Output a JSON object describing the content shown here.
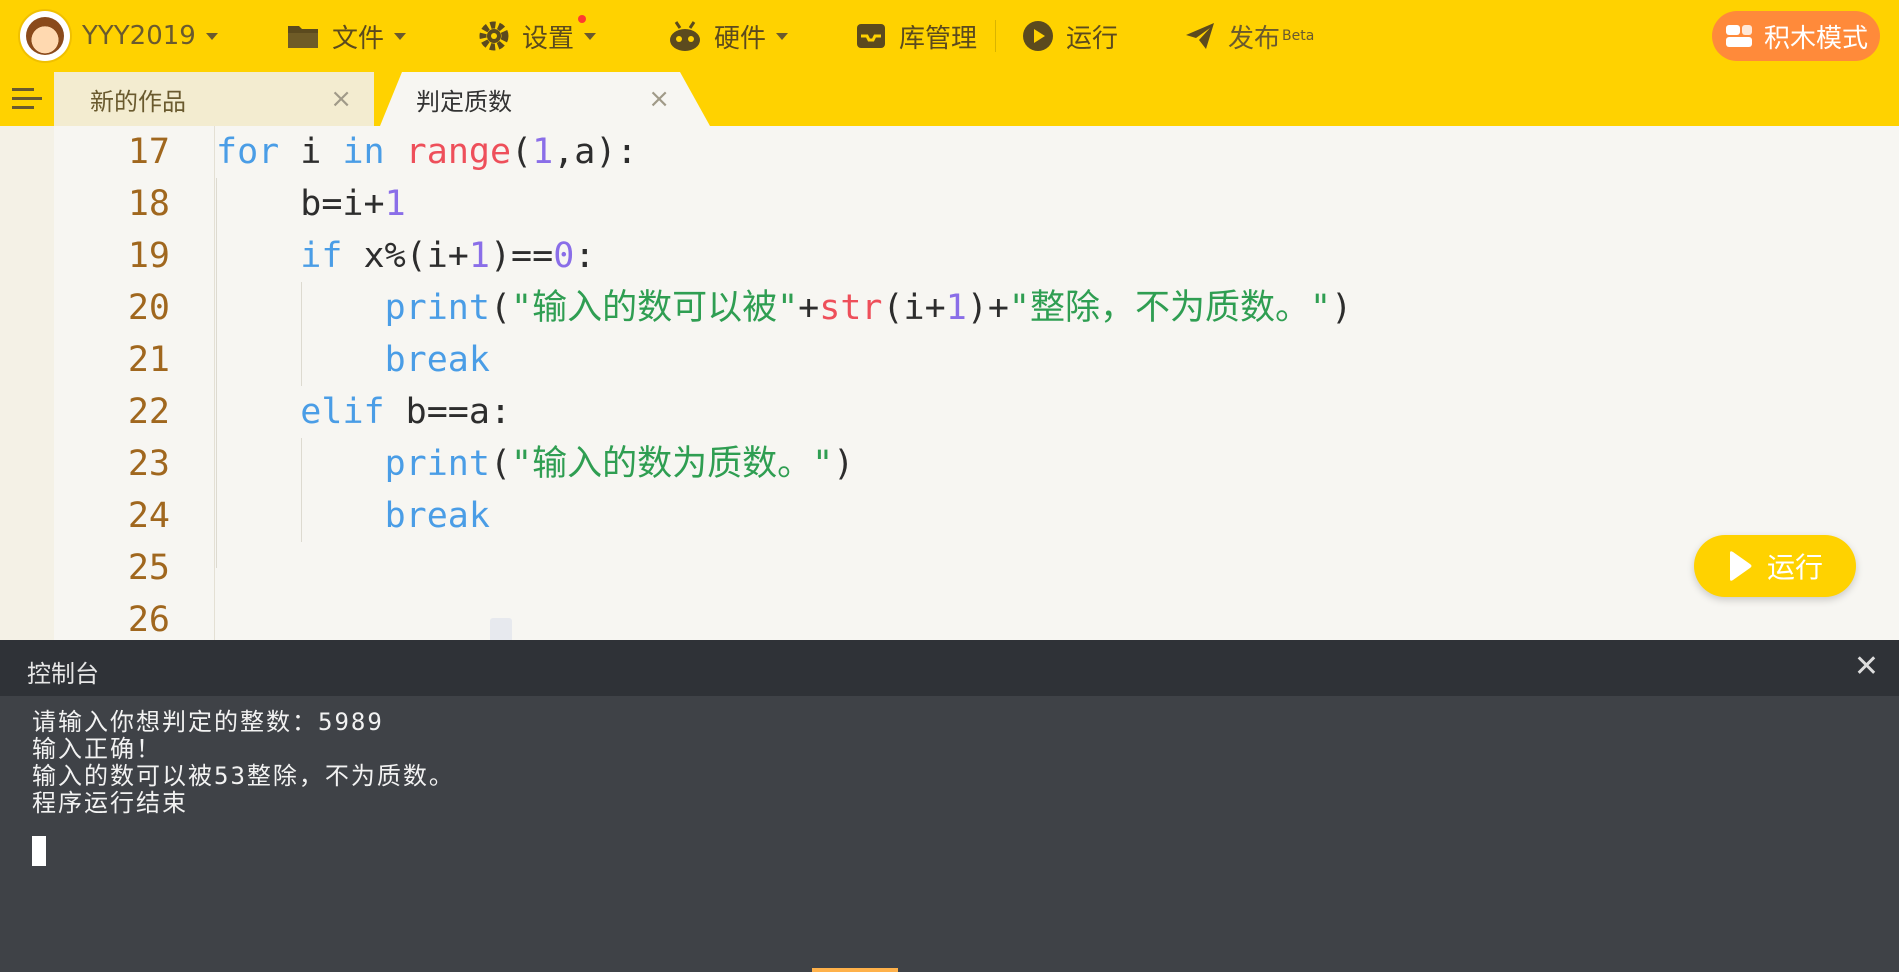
{
  "colors": {
    "accent": "#ffd200",
    "orange": "#ff8a3a",
    "keyword": "#4a9de6",
    "builtin": "#ee4f5a",
    "number": "#8a6ee8",
    "string": "#2f9e52",
    "line_number": "#a0671e",
    "console_bg": "#3f4247"
  },
  "header": {
    "user": {
      "name": "YYY2019",
      "icon": "avatar-icon"
    },
    "menu": [
      {
        "label": "文件",
        "icon": "folder-icon",
        "dropdown": true
      },
      {
        "label": "设置",
        "icon": "gear-icon",
        "dropdown": true,
        "badge_dot": true
      },
      {
        "label": "硬件",
        "icon": "robot-icon",
        "dropdown": true
      },
      {
        "label": "库管理",
        "icon": "inbox-icon",
        "dropdown": false
      },
      {
        "label": "运行",
        "icon": "play-circle-icon",
        "dropdown": false
      },
      {
        "label": "发布",
        "sup": "Beta",
        "icon": "paper-plane-icon",
        "dropdown": false
      }
    ],
    "blocks_mode_label": "积木模式"
  },
  "tabs": [
    {
      "label": "新的作品",
      "active": false
    },
    {
      "label": "判定质数",
      "active": true
    }
  ],
  "editor": {
    "line_numbers": [
      "17",
      "18",
      "19",
      "20",
      "21",
      "22",
      "23",
      "24",
      "25",
      "26"
    ],
    "lines": [
      [
        {
          "t": "for",
          "c": "kw"
        },
        {
          "t": " i "
        },
        {
          "t": "in",
          "c": "kw"
        },
        {
          "t": " "
        },
        {
          "t": "range",
          "c": "fn"
        },
        {
          "t": "("
        },
        {
          "t": "1",
          "c": "num"
        },
        {
          "t": ",a):"
        }
      ],
      [
        {
          "t": "    b=i+"
        },
        {
          "t": "1",
          "c": "num"
        }
      ],
      [
        {
          "t": "    "
        },
        {
          "t": "if",
          "c": "kw"
        },
        {
          "t": " x%(i+"
        },
        {
          "t": "1",
          "c": "num"
        },
        {
          "t": ")=="
        },
        {
          "t": "0",
          "c": "num"
        },
        {
          "t": ":"
        }
      ],
      [
        {
          "t": "        "
        },
        {
          "t": "print",
          "c": "kw"
        },
        {
          "t": "("
        },
        {
          "t": "\"输入的数可以被\"",
          "c": "str"
        },
        {
          "t": "+"
        },
        {
          "t": "str",
          "c": "fn"
        },
        {
          "t": "(i+"
        },
        {
          "t": "1",
          "c": "num"
        },
        {
          "t": ")+"
        },
        {
          "t": "\"整除，不为质数。\"",
          "c": "str"
        },
        {
          "t": ")"
        }
      ],
      [
        {
          "t": "        "
        },
        {
          "t": "break",
          "c": "kw"
        }
      ],
      [
        {
          "t": "    "
        },
        {
          "t": "elif",
          "c": "kw"
        },
        {
          "t": " b==a:"
        }
      ],
      [
        {
          "t": "        "
        },
        {
          "t": "print",
          "c": "kw"
        },
        {
          "t": "("
        },
        {
          "t": "\"输入的数为质数。\"",
          "c": "str"
        },
        {
          "t": ")"
        }
      ],
      [
        {
          "t": "        "
        },
        {
          "t": "break",
          "c": "kw"
        }
      ],
      [],
      []
    ]
  },
  "run_button_label": "运行",
  "console": {
    "title": "控制台",
    "lines": [
      "请输入你想判定的整数：5989",
      "输入正确！",
      "输入的数可以被53整除，不为质数。",
      "程序运行结束"
    ]
  }
}
